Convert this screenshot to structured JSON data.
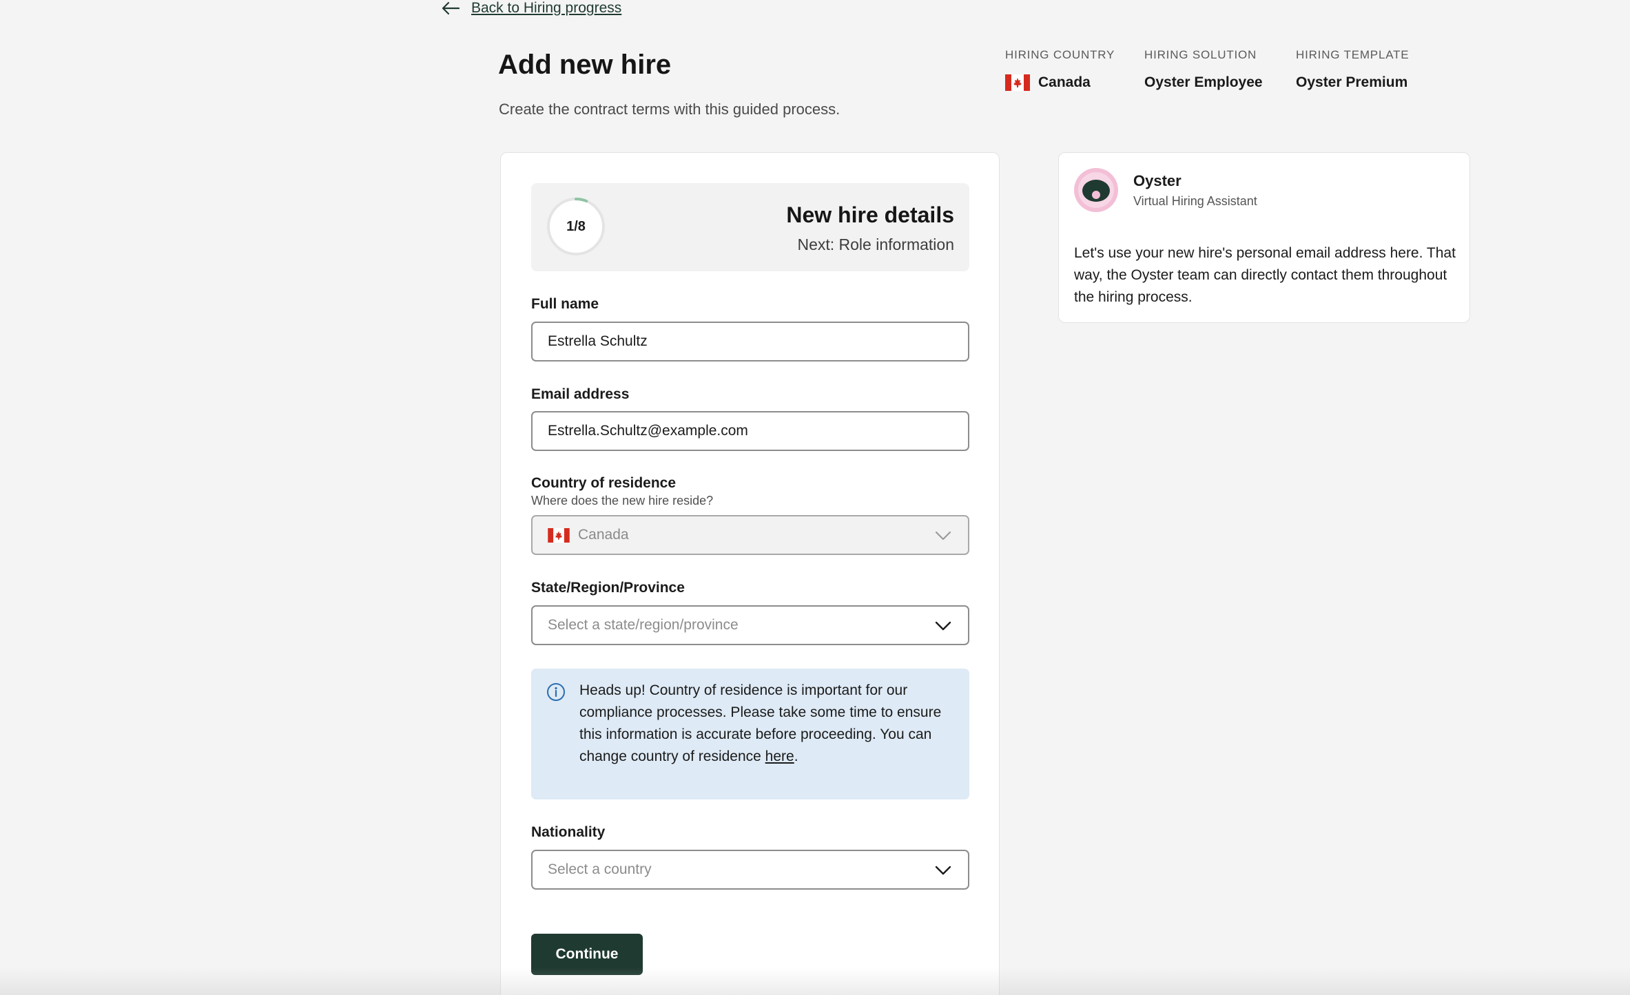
{
  "nav": {
    "back_label": "Back to Hiring progress"
  },
  "header": {
    "title": "Add new hire",
    "subtitle": "Create the contract terms with this guided process."
  },
  "meta": {
    "country_label": "HIRING COUNTRY",
    "country_value": "Canada",
    "solution_label": "HIRING SOLUTION",
    "solution_value": "Oyster Employee",
    "template_label": "HIRING TEMPLATE",
    "template_value": "Oyster Premium"
  },
  "progress": {
    "step_text": "1/8",
    "current": 1,
    "total": 8,
    "title": "New hire details",
    "next": "Next: Role information"
  },
  "form": {
    "full_name_label": "Full name",
    "full_name_value": "Estrella Schultz",
    "email_label": "Email address",
    "email_value": "Estrella.Schultz@example.com",
    "residence_label": "Country of residence",
    "residence_help": "Where does the new hire reside?",
    "residence_value": "Canada",
    "state_label": "State/Region/Province",
    "state_placeholder": "Select a state/region/province",
    "nationality_label": "Nationality",
    "nationality_placeholder": "Select a country",
    "continue_label": "Continue"
  },
  "alert": {
    "text": "Heads up! Country of residence is important for our compliance processes. Please take some time to ensure this information is accurate before proceeding. You can change country of residence ",
    "link": "here",
    "end": "."
  },
  "assistant": {
    "name": "Oyster",
    "role": "Virtual Hiring Assistant",
    "message": "Let's use your new hire's personal email address here. That way, the Oyster team can directly contact them throughout the hiring process."
  },
  "colors": {
    "brand": "#1f3a31",
    "alert_bg": "#deeaf5",
    "progress_arc": "#8fc4a3",
    "flag_red": "#d52b1e"
  },
  "icons": [
    "arrow-left-icon",
    "canada-flag-icon",
    "chevron-down-icon",
    "info-icon",
    "oyster-avatar-icon"
  ]
}
